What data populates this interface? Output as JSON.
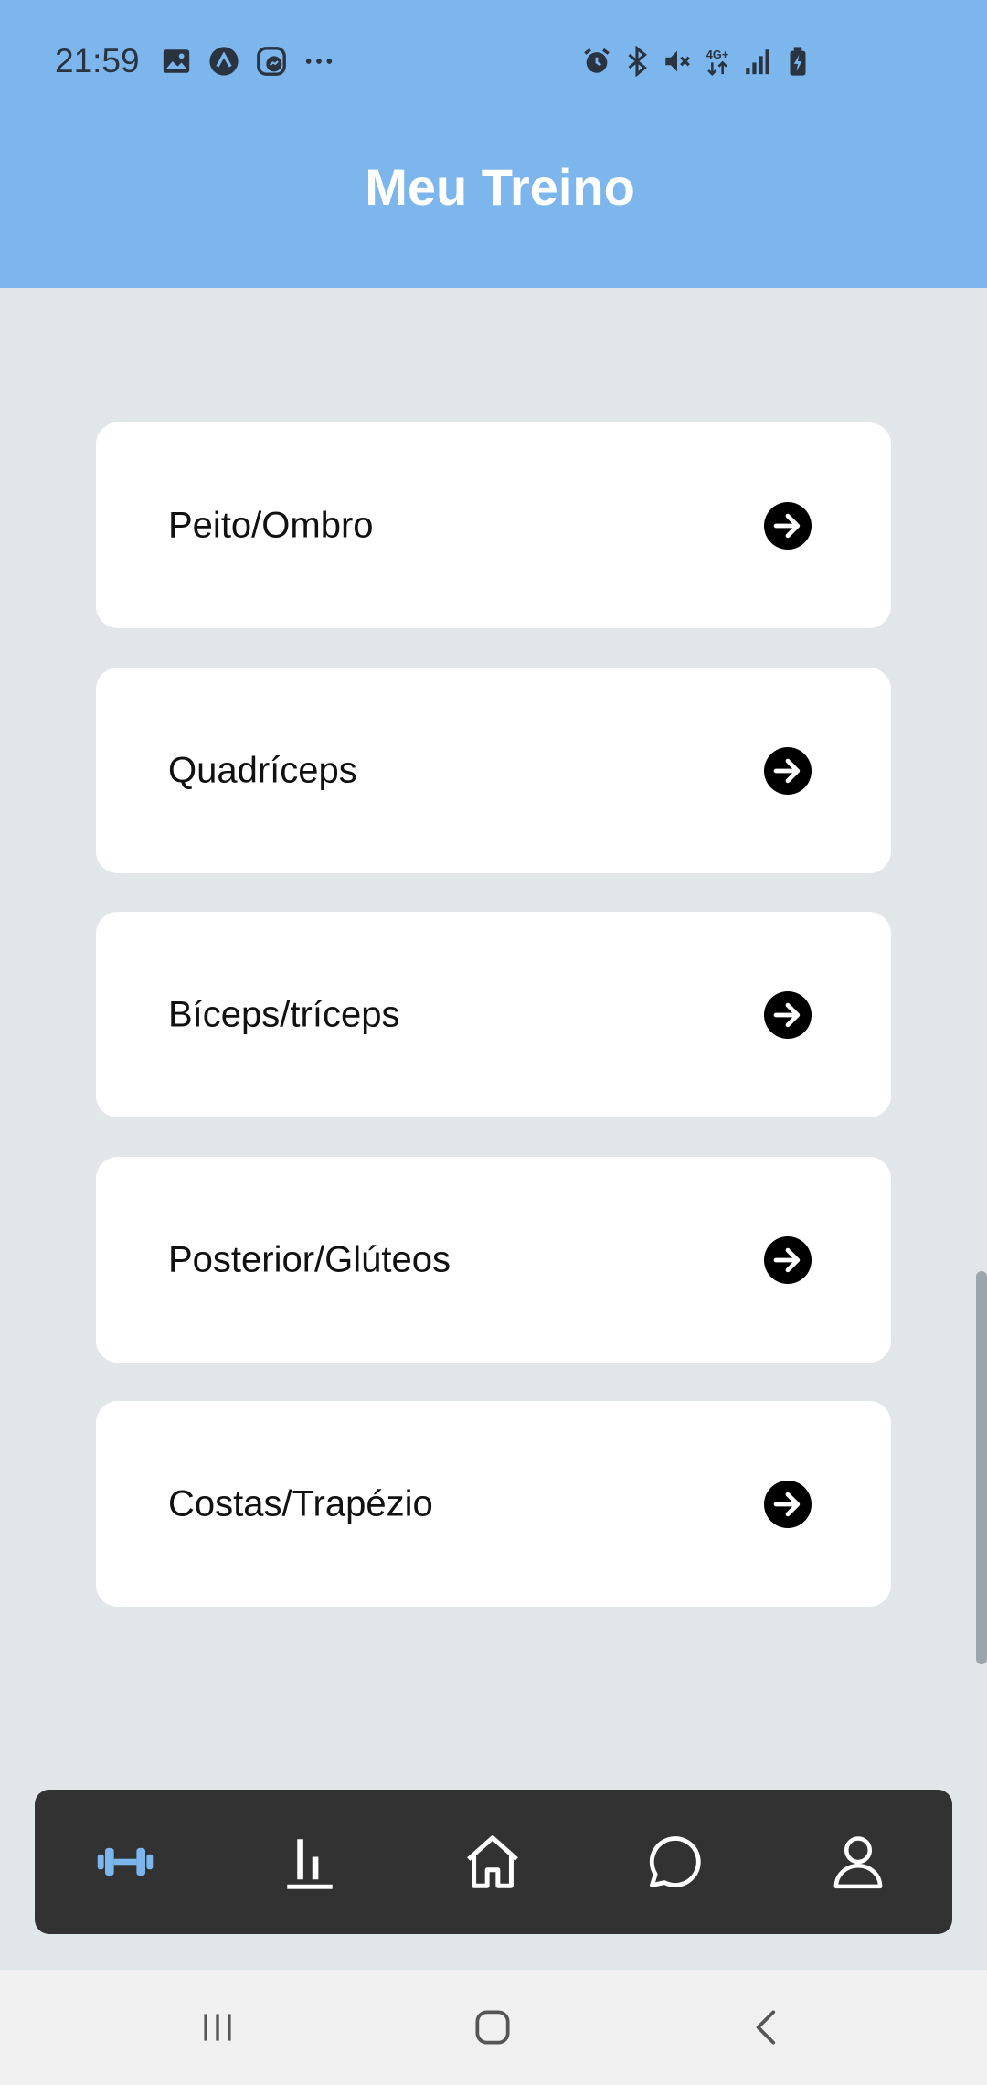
{
  "status_bar": {
    "time": "21:59",
    "left_icons": [
      "image-icon",
      "app-icon",
      "messenger-icon",
      "more-dots-icon"
    ],
    "right_icons": [
      "alarm-icon",
      "bluetooth-icon",
      "mute-icon",
      "4g-icon",
      "signal-icon",
      "battery-icon"
    ]
  },
  "header": {
    "title": "Meu Treino",
    "background": "#7db6ec"
  },
  "workouts": [
    {
      "label": "Peito/Ombro"
    },
    {
      "label": "Quadríceps"
    },
    {
      "label": "Bíceps/tríceps"
    },
    {
      "label": "Posterior/Glúteos"
    },
    {
      "label": "Costas/Trapézio"
    }
  ],
  "bottom_nav": {
    "items": [
      {
        "icon": "dumbbell-icon",
        "active": true
      },
      {
        "icon": "stats-icon",
        "active": false
      },
      {
        "icon": "home-icon",
        "active": false
      },
      {
        "icon": "chat-icon",
        "active": false
      },
      {
        "icon": "profile-icon",
        "active": false
      }
    ],
    "active_color": "#7db6ec",
    "background": "#323232"
  },
  "system_nav": [
    "recent-apps-icon",
    "home-button-icon",
    "back-icon"
  ]
}
